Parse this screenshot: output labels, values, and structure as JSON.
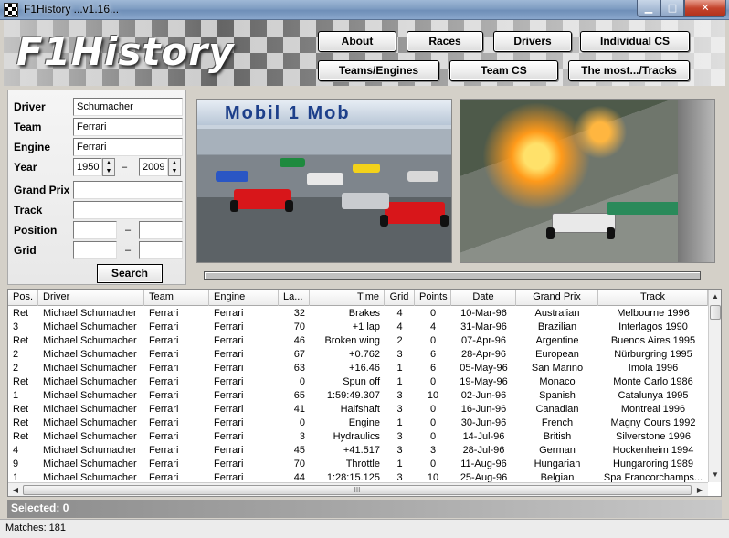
{
  "window": {
    "title": "F1History ...v1.16...",
    "min_glyph": "▁",
    "max_glyph": "□",
    "close_glyph": "✕"
  },
  "header": {
    "logo": "F1History",
    "nav": [
      "About",
      "Races",
      "Drivers",
      "Individual CS",
      "Teams/Engines",
      "Team CS",
      "The most.../Tracks"
    ]
  },
  "form": {
    "driver_label": "Driver",
    "driver_value": "Schumacher",
    "team_label": "Team",
    "team_value": "Ferrari",
    "engine_label": "Engine",
    "engine_value": "Ferrari",
    "year_label": "Year",
    "year_from": "1950",
    "year_to": "2009",
    "year_sep": "–",
    "grand_prix_label": "Grand Prix",
    "grand_prix_value": "",
    "track_label": "Track",
    "track_value": "",
    "position_label": "Position",
    "position_from": "",
    "position_to": "",
    "position_sep": "–",
    "grid_label": "Grid",
    "grid_from": "",
    "grid_to": "",
    "grid_sep": "–",
    "search_label": "Search"
  },
  "table": {
    "columns": [
      "Pos.",
      "Driver",
      "Team",
      "Engine",
      "La...",
      "Time",
      "Grid",
      "Points",
      "Date",
      "Grand Prix",
      "Track"
    ],
    "rows": [
      [
        "Ret",
        "Michael Schumacher",
        "Ferrari",
        "Ferrari",
        "32",
        "Brakes",
        "4",
        "0",
        "10-Mar-96",
        "Australian",
        "Melbourne 1996"
      ],
      [
        "3",
        "Michael Schumacher",
        "Ferrari",
        "Ferrari",
        "70",
        "+1 lap",
        "4",
        "4",
        "31-Mar-96",
        "Brazilian",
        "Interlagos 1990"
      ],
      [
        "Ret",
        "Michael Schumacher",
        "Ferrari",
        "Ferrari",
        "46",
        "Broken wing",
        "2",
        "0",
        "07-Apr-96",
        "Argentine",
        "Buenos Aires 1995"
      ],
      [
        "2",
        "Michael Schumacher",
        "Ferrari",
        "Ferrari",
        "67",
        "+0.762",
        "3",
        "6",
        "28-Apr-96",
        "European",
        "Nürburgring 1995"
      ],
      [
        "2",
        "Michael Schumacher",
        "Ferrari",
        "Ferrari",
        "63",
        "+16.46",
        "1",
        "6",
        "05-May-96",
        "San Marino",
        "Imola 1996"
      ],
      [
        "Ret",
        "Michael Schumacher",
        "Ferrari",
        "Ferrari",
        "0",
        "Spun off",
        "1",
        "0",
        "19-May-96",
        "Monaco",
        "Monte Carlo 1986"
      ],
      [
        "1",
        "Michael Schumacher",
        "Ferrari",
        "Ferrari",
        "65",
        "1:59:49.307",
        "3",
        "10",
        "02-Jun-96",
        "Spanish",
        "Catalunya 1995"
      ],
      [
        "Ret",
        "Michael Schumacher",
        "Ferrari",
        "Ferrari",
        "41",
        "Halfshaft",
        "3",
        "0",
        "16-Jun-96",
        "Canadian",
        "Montreal 1996"
      ],
      [
        "Ret",
        "Michael Schumacher",
        "Ferrari",
        "Ferrari",
        "0",
        "Engine",
        "1",
        "0",
        "30-Jun-96",
        "French",
        "Magny Cours 1992"
      ],
      [
        "Ret",
        "Michael Schumacher",
        "Ferrari",
        "Ferrari",
        "3",
        "Hydraulics",
        "3",
        "0",
        "14-Jul-96",
        "British",
        "Silverstone 1996"
      ],
      [
        "4",
        "Michael Schumacher",
        "Ferrari",
        "Ferrari",
        "45",
        "+41.517",
        "3",
        "3",
        "28-Jul-96",
        "German",
        "Hockenheim 1994"
      ],
      [
        "9",
        "Michael Schumacher",
        "Ferrari",
        "Ferrari",
        "70",
        "Throttle",
        "1",
        "0",
        "11-Aug-96",
        "Hungarian",
        "Hungaroring 1989"
      ],
      [
        "1",
        "Michael Schumacher",
        "Ferrari",
        "Ferrari",
        "44",
        "1:28:15.125",
        "3",
        "10",
        "25-Aug-96",
        "Belgian",
        "Spa Francorchamps..."
      ]
    ],
    "hthumb_grip": "III"
  },
  "footer": {
    "selected": "Selected: 0",
    "matches": "Matches: 181"
  },
  "photos": {
    "start_billboard": "Mobil 1 Mob"
  },
  "colors": {
    "ferrari_red": "#d8161a",
    "mclaren_silver": "#c9ccd0"
  }
}
